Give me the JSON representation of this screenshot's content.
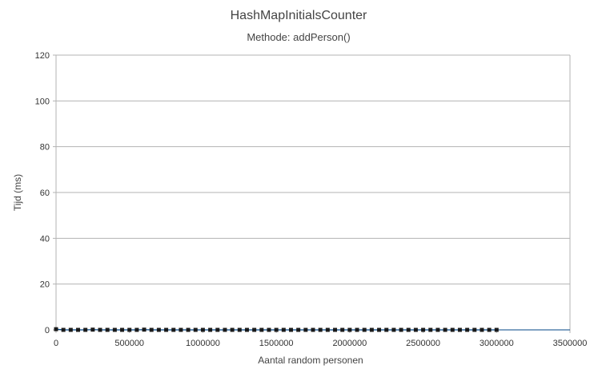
{
  "chart_data": {
    "type": "line",
    "title": "HashMapInitialsCounter",
    "subtitle": "Methode: addPerson()",
    "xlabel": "Aantal random personen",
    "ylabel": "Tijd (ms)",
    "xlim": [
      0,
      3500000
    ],
    "ylim": [
      0,
      120
    ],
    "x_ticks": [
      0,
      500000,
      1000000,
      1500000,
      2000000,
      2500000,
      3000000,
      3500000
    ],
    "x_tick_labels": [
      "0",
      "500000",
      "1000000",
      "1500000",
      "2000000",
      "2500000",
      "3000000",
      "3500000"
    ],
    "y_ticks": [
      0,
      20,
      40,
      60,
      80,
      100,
      120
    ],
    "y_tick_labels": [
      "0",
      "20",
      "40",
      "60",
      "80",
      "100",
      "120"
    ],
    "grid": true,
    "legend": "none",
    "line_color": "#004586",
    "marker": "square",
    "series": [
      {
        "x": [
          0,
          50000,
          100000,
          150000,
          200000,
          250000,
          300000,
          350000,
          400000,
          450000,
          500000,
          550000,
          600000,
          650000,
          700000,
          750000,
          800000,
          850000,
          900000,
          950000,
          1000000,
          1050000,
          1100000,
          1150000,
          1200000,
          1250000,
          1300000,
          1350000,
          1400000,
          1450000,
          1500000,
          1550000,
          1600000,
          1650000,
          1700000,
          1750000,
          1800000,
          1850000,
          1900000,
          1950000,
          2000000,
          2050000,
          2100000,
          2150000,
          2200000,
          2250000,
          2300000,
          2350000,
          2400000,
          2450000,
          2500000,
          2550000,
          2600000,
          2650000,
          2700000,
          2750000,
          2800000,
          2850000,
          2900000,
          2950000,
          3000000
        ],
        "y": [
          0.3,
          0,
          0,
          0,
          0,
          0.1,
          0,
          0,
          0,
          0,
          0,
          0,
          0.1,
          0,
          0,
          0,
          0,
          0,
          0,
          0,
          0,
          0,
          0,
          0,
          0,
          0,
          0,
          0,
          0,
          0,
          0,
          0,
          0,
          0,
          0,
          0,
          0,
          0,
          0,
          0,
          0,
          0,
          0,
          0,
          0,
          0,
          0,
          0,
          0,
          0,
          0,
          0,
          0,
          0,
          0,
          0,
          0,
          0,
          0,
          0,
          0
        ]
      }
    ]
  }
}
